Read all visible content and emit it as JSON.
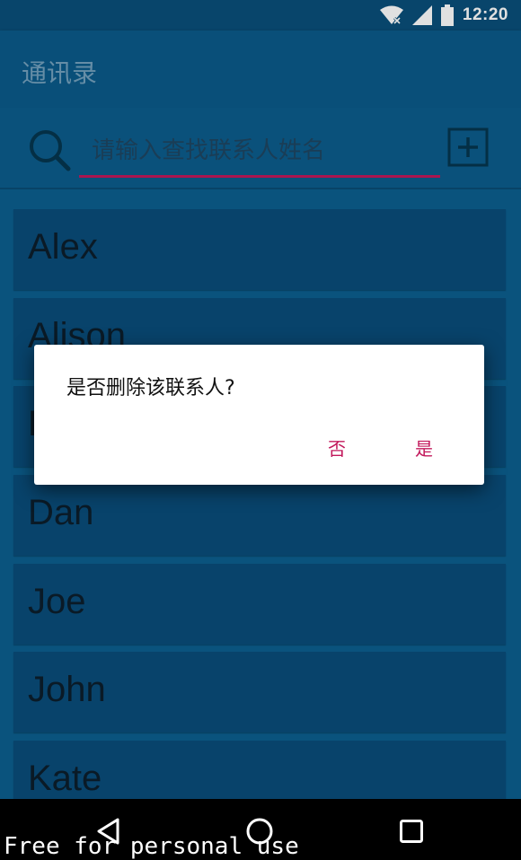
{
  "status_bar": {
    "time": "12:20"
  },
  "app_bar": {
    "title": "通讯录"
  },
  "search": {
    "placeholder": "请输入查找联系人姓名",
    "value": ""
  },
  "contacts": [
    {
      "name": "Alex"
    },
    {
      "name": "Alison"
    },
    {
      "name": "B"
    },
    {
      "name": "Dan"
    },
    {
      "name": "Joe"
    },
    {
      "name": "John"
    },
    {
      "name": "Kate"
    }
  ],
  "dialog": {
    "message": "是否删除该联系人?",
    "negative_label": "否",
    "positive_label": "是"
  },
  "watermark": "Free for personal use",
  "colors": {
    "accent": "#c2185b",
    "primary": "#0b5a8a",
    "list_item": "#0a4d7a"
  },
  "icons": {
    "search": "search-icon",
    "add": "add-box-icon",
    "back": "back-triangle-icon",
    "home": "home-circle-icon",
    "recents": "recents-square-icon"
  }
}
